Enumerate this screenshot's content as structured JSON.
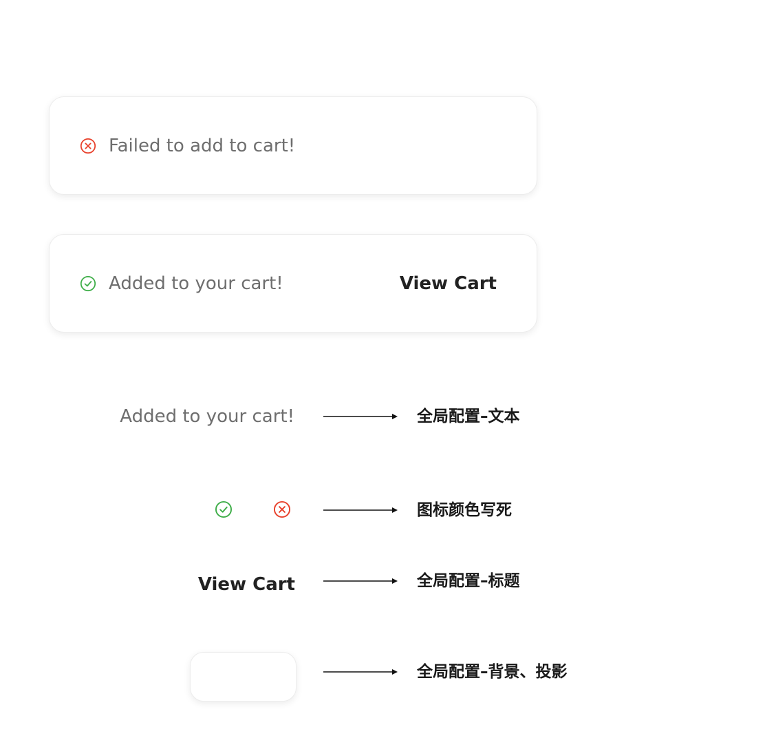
{
  "toasts": {
    "error": {
      "icon": "x-circle-icon",
      "message": "Failed to add to cart!"
    },
    "success": {
      "icon": "check-circle-icon",
      "message": "Added to your cart!",
      "action_label": "View Cart"
    }
  },
  "legend": {
    "text_sample": "Added to your cart!",
    "text_label": "全局配置–文本",
    "icons_label": "图标颜色写死",
    "title_sample": "View Cart",
    "title_label": "全局配置–标题",
    "background_label": "全局配置–背景、投影"
  },
  "colors": {
    "error": "#e8412c",
    "success": "#3fae49",
    "body_text": "#6e6e6e",
    "title_text": "#222222"
  }
}
